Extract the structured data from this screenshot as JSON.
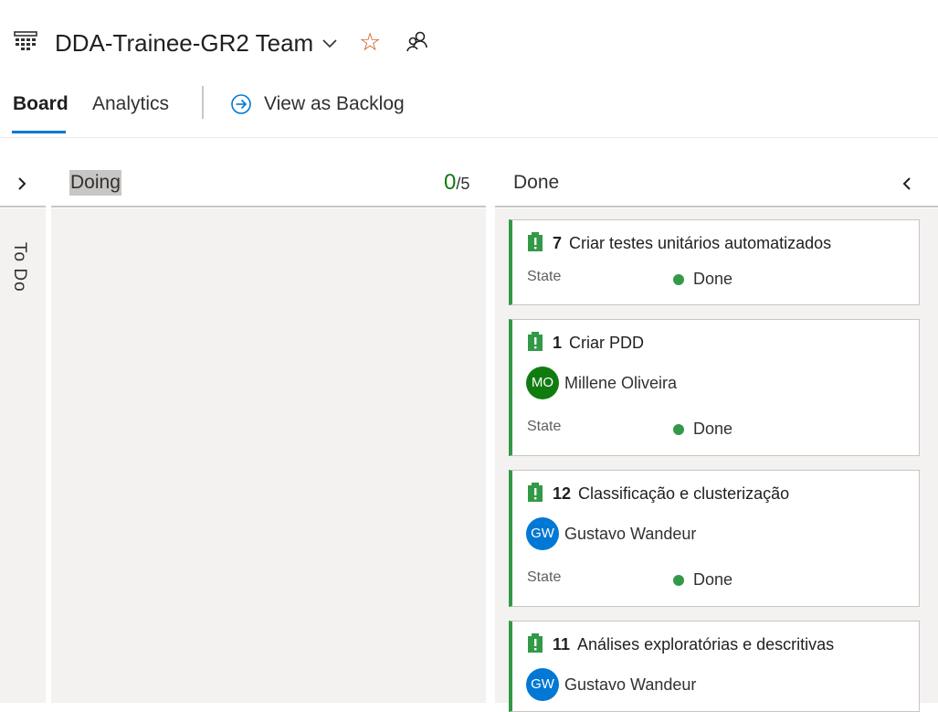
{
  "header": {
    "team_name": "DDA-Trainee-GR2 Team",
    "icons": {
      "board": "board-grid-icon",
      "dropdown": "chevron-down-icon",
      "favorite": "star-icon",
      "members": "people-icon"
    }
  },
  "tabs": [
    {
      "label": "Board",
      "selected": true
    },
    {
      "label": "Analytics",
      "selected": false
    }
  ],
  "view_as_backlog": {
    "label": "View as Backlog",
    "icon": "arrow-circle-right-icon"
  },
  "columns": {
    "todo": {
      "label": "To Do",
      "collapsed": true
    },
    "doing": {
      "label": "Doing",
      "wip_current": "0",
      "wip_limit": "/5"
    },
    "done": {
      "label": "Done"
    }
  },
  "cards": [
    {
      "id": "7",
      "title": "Criar testes unitários automatizados",
      "state_label": "State",
      "state": "Done"
    },
    {
      "id": "1",
      "title": "Criar PDD",
      "initials": "MO",
      "assignee": "Millene Oliveira",
      "avatar_color": "#107c10",
      "state_label": "State",
      "state": "Done"
    },
    {
      "id": "12",
      "title": "Classificação e clusterização",
      "initials": "GW",
      "assignee": "Gustavo Wandeur",
      "avatar_color": "#0078d4",
      "state_label": "State",
      "state": "Done"
    },
    {
      "id": "11",
      "title": "Análises exploratórias e descritivas",
      "initials": "GW",
      "assignee": "Gustavo Wandeur",
      "avatar_color": "#0078d4"
    }
  ],
  "colors": {
    "accent": "#0078d4",
    "done_green": "#339947",
    "star": "#ca5010",
    "wip_green": "#107c10"
  }
}
